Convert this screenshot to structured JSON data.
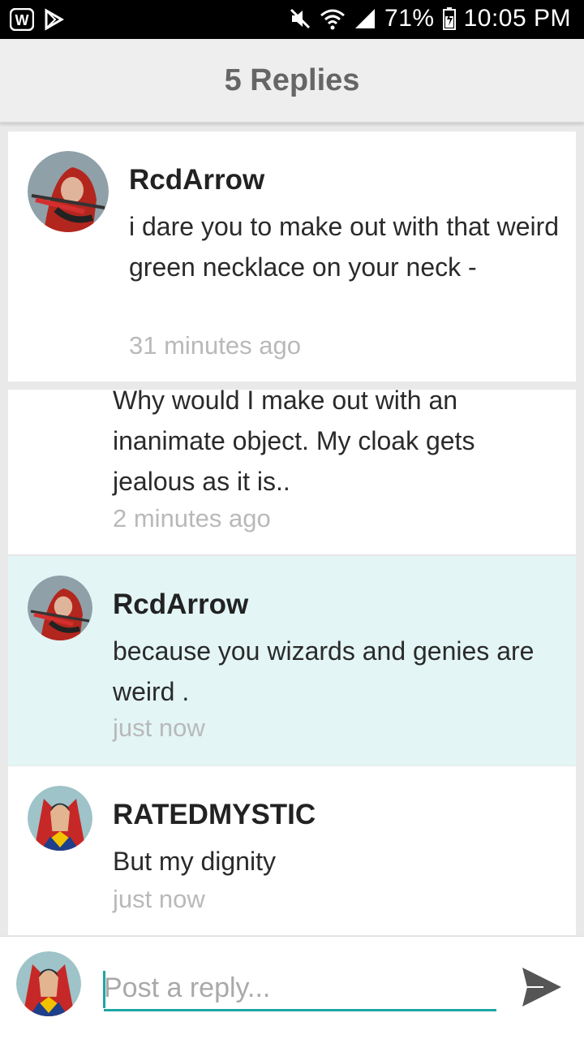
{
  "status_bar": {
    "battery": "71%",
    "time": "10:05 PM",
    "left_icons": [
      "app-w-icon",
      "play-store-icon"
    ],
    "right_icons": [
      "mute-icon",
      "wifi-icon",
      "signal-icon",
      "battery-icon"
    ]
  },
  "header": {
    "title": "5 Replies"
  },
  "comments": [
    {
      "username": "RcdArrow",
      "text": "i dare you to make out with that weird green necklace on your neck -",
      "time": "31 minutes ago",
      "avatar": "red-arrow-avatar"
    },
    {
      "username": "",
      "text": "Why would I make out with an inanimate object. My cloak gets jealous as it is..",
      "time": "2 minutes ago",
      "avatar": ""
    },
    {
      "username": "RcdArrow",
      "text": "because you wizards and genies are weird .",
      "time": "just now",
      "avatar": "red-arrow-avatar",
      "highlighted": true
    },
    {
      "username": "RATEDMYSTIC",
      "text": "But my dignity",
      "time": "just now",
      "avatar": "mystic-avatar"
    }
  ],
  "reply": {
    "placeholder": "Post a reply...",
    "send_icon": "send-icon"
  },
  "colors": {
    "accent": "#1fa6a6",
    "highlight": "#e3f5f5"
  }
}
